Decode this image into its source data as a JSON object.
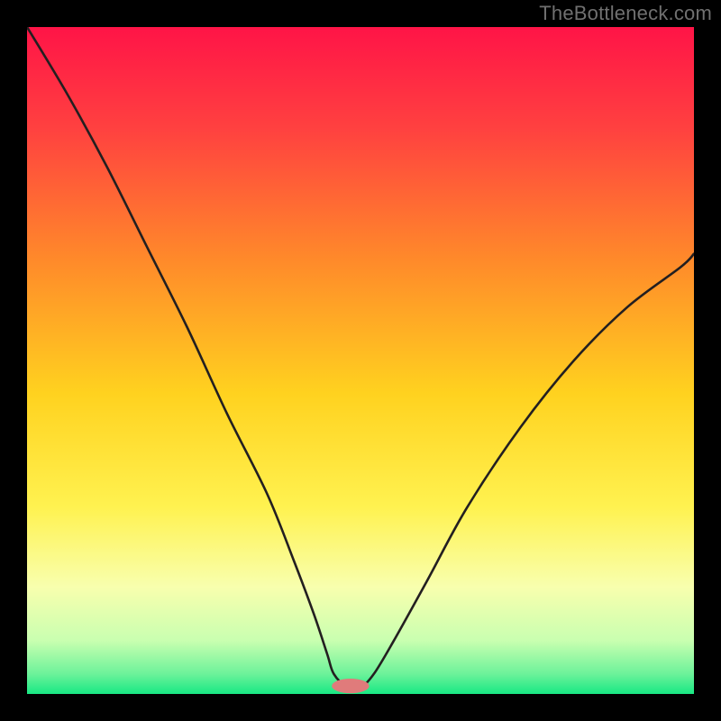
{
  "watermark": "TheBottleneck.com",
  "chart_data": {
    "type": "line",
    "title": "",
    "xlabel": "",
    "ylabel": "",
    "xlim": [
      0,
      100
    ],
    "ylim": [
      0,
      100
    ],
    "series": [
      {
        "name": "bottleneck-curve",
        "x": [
          0,
          6,
          12,
          18,
          24,
          30,
          36,
          40,
          43,
          45,
          46,
          48,
          50,
          52,
          55,
          60,
          66,
          74,
          82,
          90,
          98,
          100
        ],
        "values": [
          100,
          90,
          79,
          67,
          55,
          42,
          30,
          20,
          12,
          6,
          3,
          1,
          1,
          3,
          8,
          17,
          28,
          40,
          50,
          58,
          64,
          66
        ]
      }
    ],
    "marker": {
      "x": 48.5,
      "y": 1.2,
      "rx": 2.8,
      "ry": 1.1,
      "color": "#e07b7b"
    },
    "gradient_stops": [
      {
        "offset": 0.0,
        "color": "#ff1447"
      },
      {
        "offset": 0.15,
        "color": "#ff4040"
      },
      {
        "offset": 0.35,
        "color": "#ff8a2a"
      },
      {
        "offset": 0.55,
        "color": "#ffd21f"
      },
      {
        "offset": 0.72,
        "color": "#fff250"
      },
      {
        "offset": 0.84,
        "color": "#f8ffae"
      },
      {
        "offset": 0.92,
        "color": "#c9ffb0"
      },
      {
        "offset": 0.97,
        "color": "#6cf29a"
      },
      {
        "offset": 1.0,
        "color": "#18e884"
      }
    ],
    "curve_stroke": "#231f20",
    "curve_width": 2.6
  }
}
